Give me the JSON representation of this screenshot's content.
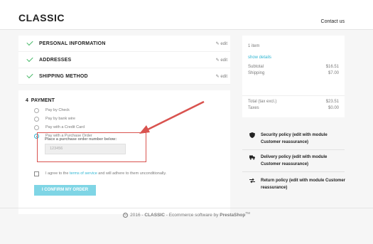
{
  "header": {
    "logo": "CLASSIC",
    "contact": "Contact us"
  },
  "steps": [
    {
      "title": "PERSONAL INFORMATION",
      "edit": "edit"
    },
    {
      "title": "ADDRESSES",
      "edit": "edit"
    },
    {
      "title": "SHIPPING METHOD",
      "edit": "edit"
    }
  ],
  "payment": {
    "number": "4",
    "title": "PAYMENT",
    "options": [
      "Pay by Check",
      "Pay by bank wire",
      "Pay with a Credit Card",
      "Pay with a Purchase Order"
    ],
    "selected_index": 3,
    "po_label": "Place a purchase order number below:",
    "po_placeholder": "123456",
    "terms_pre": "I agree to the ",
    "terms_link": "terms of service",
    "terms_post": " and will adhere to them unconditionally.",
    "confirm": "I CONFIRM MY ORDER"
  },
  "summary": {
    "items": "1 item",
    "details": "show details",
    "subtotal_label": "Subtotal",
    "subtotal_value": "$16.51",
    "shipping_label": "Shipping",
    "shipping_value": "$7.00",
    "total_label": "Total (tax excl.)",
    "total_value": "$23.51",
    "taxes_label": "Taxes",
    "taxes_value": "$0.00"
  },
  "reassurance": [
    {
      "icon": "shield-icon",
      "text": "Security policy (edit with module Customer reassurance)"
    },
    {
      "icon": "truck-icon",
      "text": "Delivery policy (edit with module Customer reassurance)"
    },
    {
      "icon": "return-arrows-icon",
      "text": "Return policy (edit with module Customer reassurance)"
    }
  ],
  "footer": {
    "copyright": "©",
    "year": "2016 - ",
    "brand": "CLASSIC",
    "mid": " - Ecommerce software by ",
    "vendor": "PrestaShop",
    "tm": "TM"
  },
  "colors": {
    "accent": "#2fb5d2",
    "check": "#4cbb6c",
    "highlight": "#d9534f"
  }
}
